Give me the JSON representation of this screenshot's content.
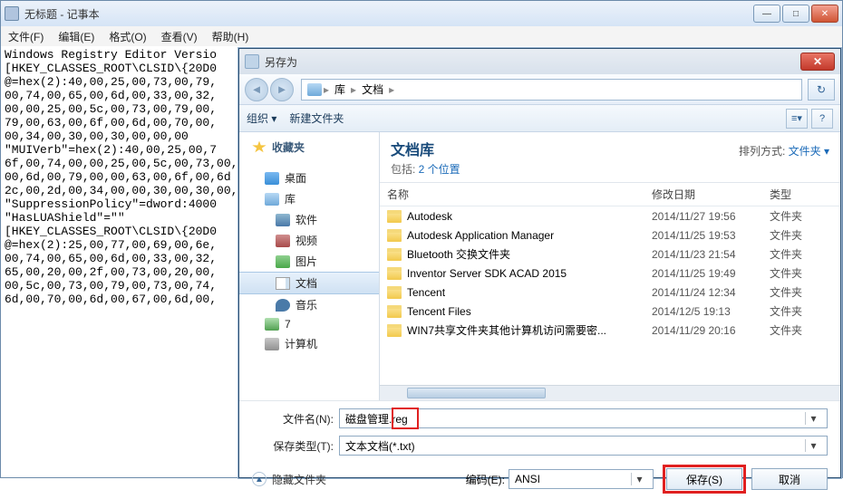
{
  "notepad": {
    "title": "无标题 - 记事本",
    "menu": [
      "文件(F)",
      "编辑(E)",
      "格式(O)",
      "查看(V)",
      "帮助(H)"
    ],
    "content": "Windows Registry Editor Versio\n[HKEY_CLASSES_ROOT\\CLSID\\{20D0\n@=hex(2):40,00,25,00,73,00,79,\n00,74,00,65,00,6d,00,33,00,32,\n00,00,25,00,5c,00,73,00,79,00,\n79,00,63,00,6f,00,6d,00,70,00,\n00,34,00,30,00,30,00,00,00\n\"MUIVerb\"=hex(2):40,00,25,00,7\n6f,00,74,00,00,25,00,5c,00,73,00,\n00,6d,00,79,00,00,63,00,6f,00,6d\n2c,00,2d,00,34,00,00,30,00,30,00,\n\"SuppressionPolicy\"=dword:4000\n\"HasLUAShield\"=\"\"\n[HKEY_CLASSES_ROOT\\CLSID\\{20D0\n@=hex(2):25,00,77,00,69,00,6e,\n00,74,00,65,00,6d,00,33,00,32,\n65,00,20,00,2f,00,73,00,20,00,\n00,5c,00,73,00,79,00,73,00,74,\n6d,00,70,00,6d,00,67,00,6d,00,"
  },
  "dialog": {
    "title": "另存为",
    "nav": {
      "segments": [
        "库",
        "文档"
      ]
    },
    "toolbar": {
      "organize": "组织 ▾",
      "newfolder": "新建文件夹"
    },
    "sidebar": {
      "favorites": "收藏夹",
      "desktop": "桌面",
      "libraries": "库",
      "software": "软件",
      "videos": "视频",
      "pictures": "图片",
      "documents": "文档",
      "music": "音乐",
      "seven": "7",
      "computer": "计算机"
    },
    "pane": {
      "heading": "文档库",
      "subtext_prefix": "包括: ",
      "subtext_link": "2 个位置",
      "arrange_label": "排列方式:",
      "arrange_value": "文件夹 ▾",
      "columns": {
        "name": "名称",
        "date": "修改日期",
        "type": "类型"
      },
      "rows": [
        {
          "name": "Autodesk",
          "date": "2014/11/27 19:56",
          "type": "文件夹"
        },
        {
          "name": "Autodesk Application Manager",
          "date": "2014/11/25 19:53",
          "type": "文件夹"
        },
        {
          "name": "Bluetooth 交换文件夹",
          "date": "2014/11/23 21:54",
          "type": "文件夹"
        },
        {
          "name": "Inventor Server SDK ACAD 2015",
          "date": "2014/11/25 19:49",
          "type": "文件夹"
        },
        {
          "name": "Tencent",
          "date": "2014/11/24 12:34",
          "type": "文件夹"
        },
        {
          "name": "Tencent Files",
          "date": "2014/12/5 19:13",
          "type": "文件夹"
        },
        {
          "name": "WIN7共享文件夹其他计算机访问需要密...",
          "date": "2014/11/29 20:16",
          "type": "文件夹"
        }
      ]
    },
    "form": {
      "filename_label": "文件名(N):",
      "filename_value": "磁盘管理.reg",
      "filetype_label": "保存类型(T):",
      "filetype_value": "文本文档(*.txt)",
      "hide_folders": "隐藏文件夹",
      "encoding_label": "编码(E):",
      "encoding_value": "ANSI",
      "save": "保存(S)",
      "cancel": "取消"
    }
  }
}
